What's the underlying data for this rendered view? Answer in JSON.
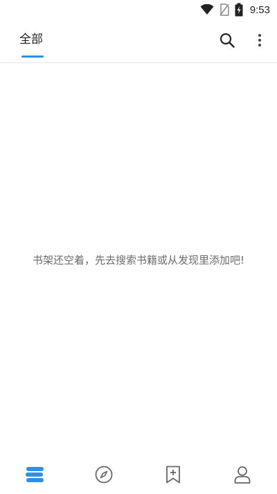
{
  "status_bar": {
    "time": "9:53",
    "icons": [
      "wifi-icon",
      "no-sim-icon",
      "battery-charging-icon"
    ]
  },
  "header": {
    "active_tab": "全部",
    "accent_color": "#2e8fe6",
    "actions": [
      "search-icon",
      "more-vertical-icon"
    ]
  },
  "empty_state": {
    "message": "书架还空着，先去搜索书籍或从发现里添加吧!"
  },
  "bottom_nav": {
    "items": [
      {
        "icon": "bookshelf-icon",
        "active": true
      },
      {
        "icon": "compass-icon",
        "active": false
      },
      {
        "icon": "bookmark-add-icon",
        "active": false
      },
      {
        "icon": "user-icon",
        "active": false
      }
    ],
    "active_color": "#2e8fe6",
    "inactive_color": "#666666"
  }
}
